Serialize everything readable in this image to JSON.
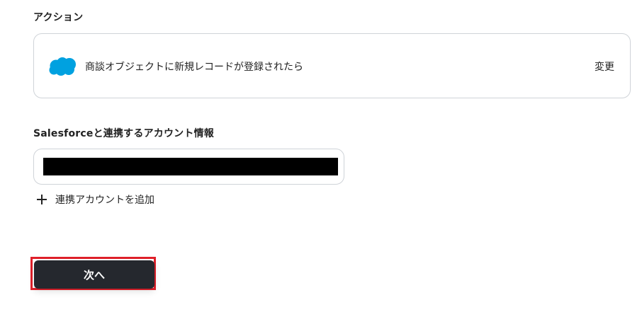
{
  "action": {
    "section_label": "アクション",
    "trigger_text": "商談オブジェクトに新規レコードが登録されたら",
    "change_label": "変更",
    "app_icon": "salesforce-cloud-icon",
    "app_color": "#00A1E0"
  },
  "account": {
    "section_label": "Salesforceと連携するアカウント情報",
    "selected_value_redacted": true,
    "add_label": "連携アカウントを追加",
    "add_icon": "plus-icon"
  },
  "footer": {
    "next_label": "次へ",
    "highlight_color": "#E0202A",
    "button_color": "#25282E"
  }
}
